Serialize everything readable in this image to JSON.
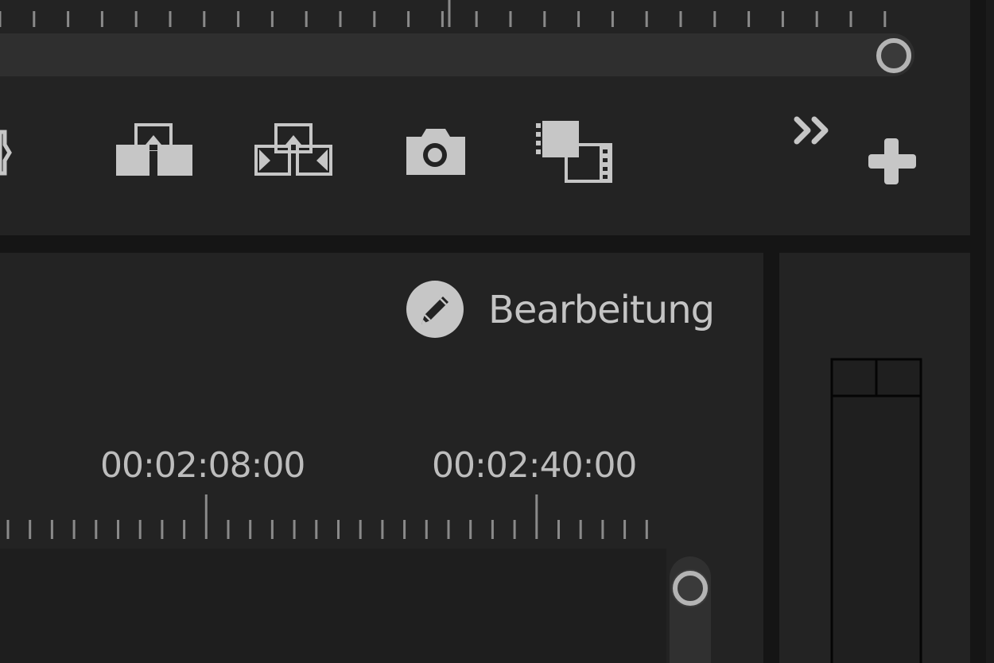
{
  "workspace": {
    "label": "Bearbeitung"
  },
  "timeline": {
    "timecodes": [
      "00:02:08:00",
      "00:02:40:00"
    ]
  },
  "toolbar": {
    "buttons": [
      {
        "name": "lift-button",
        "icon": "lift-icon"
      },
      {
        "name": "extract-button",
        "icon": "extract-icon"
      },
      {
        "name": "export-frame-button",
        "icon": "camera-icon"
      },
      {
        "name": "comparison-view-button",
        "icon": "comparison-view-icon"
      },
      {
        "name": "overflow-button",
        "icon": "double-chevron-right-icon"
      },
      {
        "name": "button-editor-button",
        "icon": "plus-icon"
      }
    ]
  },
  "colors": {
    "panel": "#232323",
    "background": "#151515",
    "icon": "#c6c6c6",
    "text": "#c4c4c4"
  }
}
